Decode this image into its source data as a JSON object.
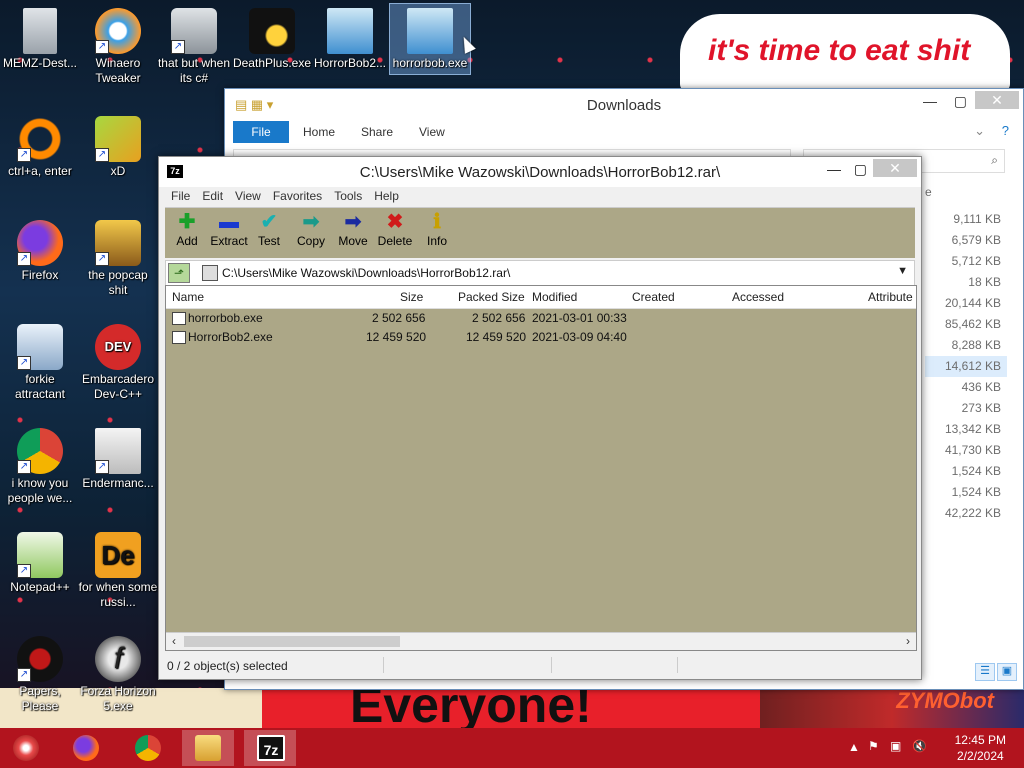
{
  "desktop": {
    "banner_top_text": "it's time to eat shit",
    "banner_bottom_text": "Everyone!",
    "banner_right_text": "ZYMObot",
    "icons": [
      {
        "label": "MEMZ-Dest..."
      },
      {
        "label": "Winaero Tweaker"
      },
      {
        "label": "that but when its c#"
      },
      {
        "label": "DeathPlus.exe"
      },
      {
        "label": "HorrorBob2..."
      },
      {
        "label": "horrorbob.exe"
      },
      {
        "label": "ctrl+a, enter"
      },
      {
        "label": "xD"
      },
      {
        "label": "Firefox"
      },
      {
        "label": "the popcap shit"
      },
      {
        "label": "forkie attractant"
      },
      {
        "label": "Embarcadero Dev-C++"
      },
      {
        "label": "i know you people we..."
      },
      {
        "label": "Endermanc..."
      },
      {
        "label": "Notepad++"
      },
      {
        "label": "for when some russi..."
      },
      {
        "label": "Papers, Please"
      },
      {
        "label": "Forza Horizon 5.exe"
      }
    ]
  },
  "explorer": {
    "title": "Downloads",
    "ribbon": {
      "file": "File",
      "home": "Home",
      "share": "Share",
      "view": "View"
    },
    "partial_col_header": "e",
    "sizes": [
      "9,111 KB",
      "6,579 KB",
      "5,712 KB",
      "18 KB",
      "20,144 KB",
      "85,462 KB",
      "8,288 KB",
      "14,612 KB",
      "436 KB",
      "273 KB",
      "13,342 KB",
      "41,730 KB",
      "1,524 KB",
      "1,524 KB",
      "42,222 KB"
    ]
  },
  "sevenzip": {
    "logo": "7z",
    "title": "C:\\Users\\Mike Wazowski\\Downloads\\HorrorBob12.rar\\",
    "menu": {
      "file": "File",
      "edit": "Edit",
      "view": "View",
      "favorites": "Favorites",
      "tools": "Tools",
      "help": "Help"
    },
    "toolbar": {
      "add": "Add",
      "extract": "Extract",
      "test": "Test",
      "copy": "Copy",
      "move": "Move",
      "delete": "Delete",
      "info": "Info"
    },
    "path": "C:\\Users\\Mike Wazowski\\Downloads\\HorrorBob12.rar\\",
    "columns": {
      "name": "Name",
      "size": "Size",
      "packed": "Packed Size",
      "modified": "Modified",
      "created": "Created",
      "accessed": "Accessed",
      "attributes": "Attribute"
    },
    "files": [
      {
        "name": "horrorbob.exe",
        "size": "2 502 656",
        "packed": "2 502 656",
        "modified": "2021-03-01 00:33"
      },
      {
        "name": "HorrorBob2.exe",
        "size": "12 459 520",
        "packed": "12 459 520",
        "modified": "2021-03-09 04:40"
      }
    ],
    "status": "0 / 2 object(s) selected"
  },
  "taskbar": {
    "time": "12:45 PM",
    "date": "2/2/2024",
    "active_app": "7z",
    "app_icons": [
      "start-icon",
      "firefox-icon",
      "chrome-icon",
      "file-explorer-icon",
      "7zip-icon"
    ]
  },
  "colors": {
    "taskbar": "#b2141e",
    "list_bg": "#aca787",
    "accent": "#1979ca"
  }
}
